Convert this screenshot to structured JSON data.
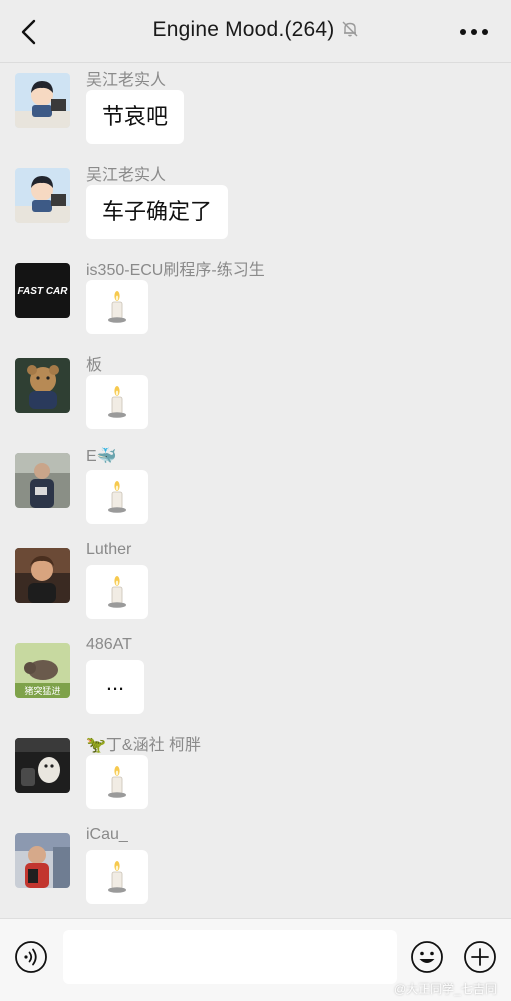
{
  "header": {
    "title": "Engine Mood.(264)",
    "back_icon": "chevron-left-icon",
    "mute_icon": "bell-off-icon",
    "more_icon": "more-dots-icon"
  },
  "messages": [
    {
      "sender": "吴江老实人",
      "type": "text",
      "text": "节哀吧",
      "avatar": "boy-at-desk-avatar"
    },
    {
      "sender": "吴江老实人",
      "type": "text",
      "text": "车子确定了",
      "avatar": "boy-at-desk-avatar"
    },
    {
      "sender": "is350-ECU刷程序-练习生",
      "type": "emoji",
      "emoji": "candle-icon",
      "avatar": "fast-car-logo-avatar",
      "avatar_text": "FAST CAR"
    },
    {
      "sender": "板",
      "type": "emoji",
      "emoji": "candle-icon",
      "avatar": "teddy-bear-avatar"
    },
    {
      "sender": "E🐳",
      "type": "emoji",
      "emoji": "candle-icon",
      "avatar": "person-photo-avatar"
    },
    {
      "sender": "Luther",
      "type": "emoji",
      "emoji": "candle-icon",
      "avatar": "portrait-photo-avatar"
    },
    {
      "sender": "486AT",
      "type": "text",
      "text": "...",
      "avatar": "boar-cartoon-avatar",
      "avatar_text": "猪突猛进"
    },
    {
      "sender": "🦖丁&涵社  柯胖",
      "type": "emoji",
      "emoji": "candle-icon",
      "avatar": "dog-photo-avatar"
    },
    {
      "sender": "iCau_",
      "type": "emoji",
      "emoji": "candle-icon",
      "avatar": "shop-photo-avatar"
    }
  ],
  "input_bar": {
    "voice_icon": "voice-input-icon",
    "emoji_icon": "emoji-face-icon",
    "plus_icon": "plus-circle-icon",
    "text_value": ""
  },
  "watermark": "@大正同学_七吉同",
  "colors": {
    "background": "#ededed",
    "bubble": "#ffffff",
    "name": "#8a8a8a"
  }
}
